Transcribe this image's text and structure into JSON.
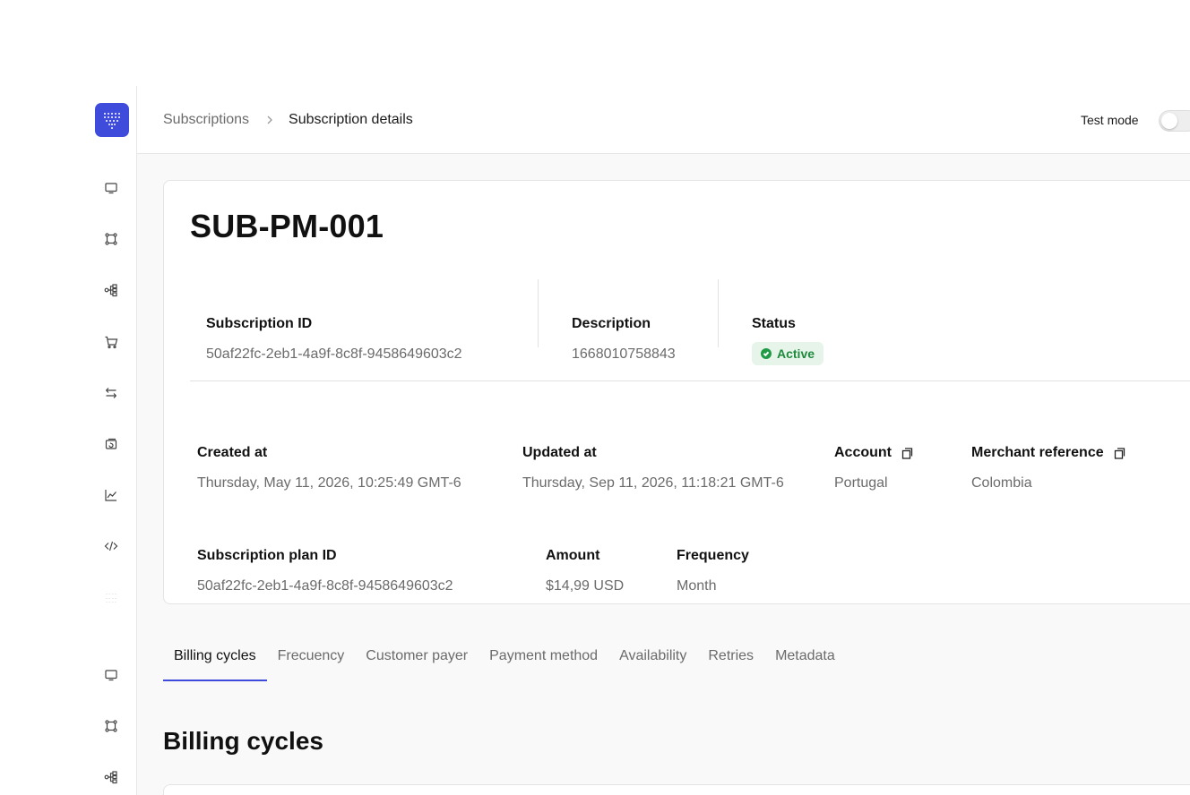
{
  "breadcrumb": {
    "parent": "Subscriptions",
    "current": "Subscription details"
  },
  "header": {
    "test_mode_label": "Test mode",
    "test_mode_on": false
  },
  "subscription": {
    "title": "SUB-PM-001",
    "fields_row1": {
      "subscription_id_label": "Subscription ID",
      "subscription_id_value": "50af22fc-2eb1-4a9f-8c8f-9458649603c2",
      "description_label": "Description",
      "description_value": "1668010758843",
      "status_label": "Status",
      "status_value": "Active"
    },
    "fields_row2": {
      "created_label": "Created at",
      "created_value": "Thursday, May 11, 2026, 10:25:49 GMT-6",
      "updated_label": "Updated at",
      "updated_value": "Thursday, Sep 11, 2026, 11:18:21 GMT-6",
      "account_label": "Account",
      "account_value": "Portugal",
      "merchant_ref_label": "Merchant reference",
      "merchant_ref_value": "Colombia"
    },
    "fields_row3": {
      "plan_id_label": "Subscription plan ID",
      "plan_id_value": "50af22fc-2eb1-4a9f-8c8f-9458649603c2",
      "amount_label": "Amount",
      "amount_value": "$14,99 USD",
      "frequency_label": "Frequency",
      "frequency_value": "Month"
    }
  },
  "tabs": [
    {
      "label": "Billing cycles",
      "active": true
    },
    {
      "label": "Frecuency",
      "active": false
    },
    {
      "label": "Customer payer",
      "active": false
    },
    {
      "label": "Payment method",
      "active": false
    },
    {
      "label": "Availability",
      "active": false
    },
    {
      "label": "Retries",
      "active": false
    },
    {
      "label": "Metadata",
      "active": false
    }
  ],
  "section": {
    "title": "Billing cycles"
  },
  "colors": {
    "accent": "#3e4bdb",
    "status_active_bg": "#e7f4ea",
    "status_active_text": "#1f8a3d"
  },
  "sidebar": {
    "icons": [
      "monitor-icon",
      "connections-icon",
      "workflow-icon",
      "cart-icon",
      "transfer-icon",
      "subscriptions-icon",
      "chart-icon",
      "code-icon",
      "grid-icon",
      "monitor-icon",
      "connections-icon",
      "workflow-icon"
    ]
  }
}
